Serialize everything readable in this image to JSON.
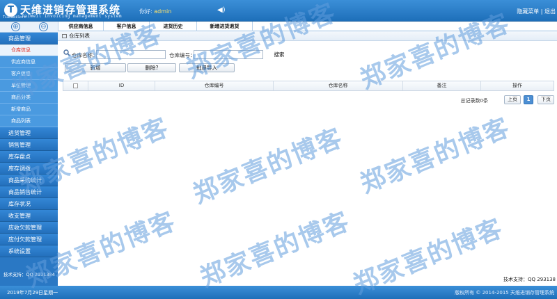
{
  "header": {
    "logo_letter": "T",
    "title": "天维进销存管理系统",
    "brand_small": "TianWeiSoft",
    "subtitle": "TaiWeil Invoicing management system",
    "welcome_label": "你好:",
    "username": "admin",
    "links_text": "隐藏菜单 | 退出"
  },
  "sidebar": {
    "expand_symbol": "⊕",
    "collapse_symbol": "⊖",
    "groups": [
      {
        "label": "商品管理"
      },
      {
        "label": "进货管理"
      },
      {
        "label": "销售管理"
      },
      {
        "label": "库存盘点"
      },
      {
        "label": "库存调拨"
      },
      {
        "label": "商品采购统计"
      },
      {
        "label": "商品销售统计"
      },
      {
        "label": "库存状况"
      },
      {
        "label": "收支管理"
      },
      {
        "label": "应收欠款管理"
      },
      {
        "label": "应付欠款管理"
      },
      {
        "label": "系统设置"
      }
    ],
    "subitems": [
      {
        "label": "仓库信息"
      },
      {
        "label": "供应商信息"
      },
      {
        "label": "客户信息"
      },
      {
        "label": "单位管理"
      },
      {
        "label": "商品分类"
      },
      {
        "label": "新增商品"
      },
      {
        "label": "商品列表"
      }
    ],
    "support": "技术支持：QQ 2931384"
  },
  "tabs": [
    {
      "label": "供应商信息"
    },
    {
      "label": "客户信息"
    },
    {
      "label": "进货历史"
    },
    {
      "label": "新增进货退货"
    }
  ],
  "panel": {
    "title": "仓库列表",
    "search": {
      "name_label": "仓库名称：",
      "name_value": "",
      "code_label": "仓库编号：",
      "code_value": "",
      "search_button": "搜索"
    },
    "actions": {
      "add": "新增",
      "delete": "删除?",
      "import": "批量导入"
    },
    "table": {
      "columns": [
        "ID",
        "仓库编号",
        "仓库名称",
        "备注",
        "操作"
      ],
      "rows": []
    },
    "pager": {
      "total": "总记录数0条",
      "prev": "上页",
      "current": "1",
      "next": "下页"
    },
    "support": "技术支持：QQ 293138"
  },
  "footer": {
    "date": "2019年7月29日星期一",
    "copyright": "版权所有 © 2014-2015 天维进销存管理系统"
  },
  "watermark": {
    "text": "郑家喜的博客"
  }
}
